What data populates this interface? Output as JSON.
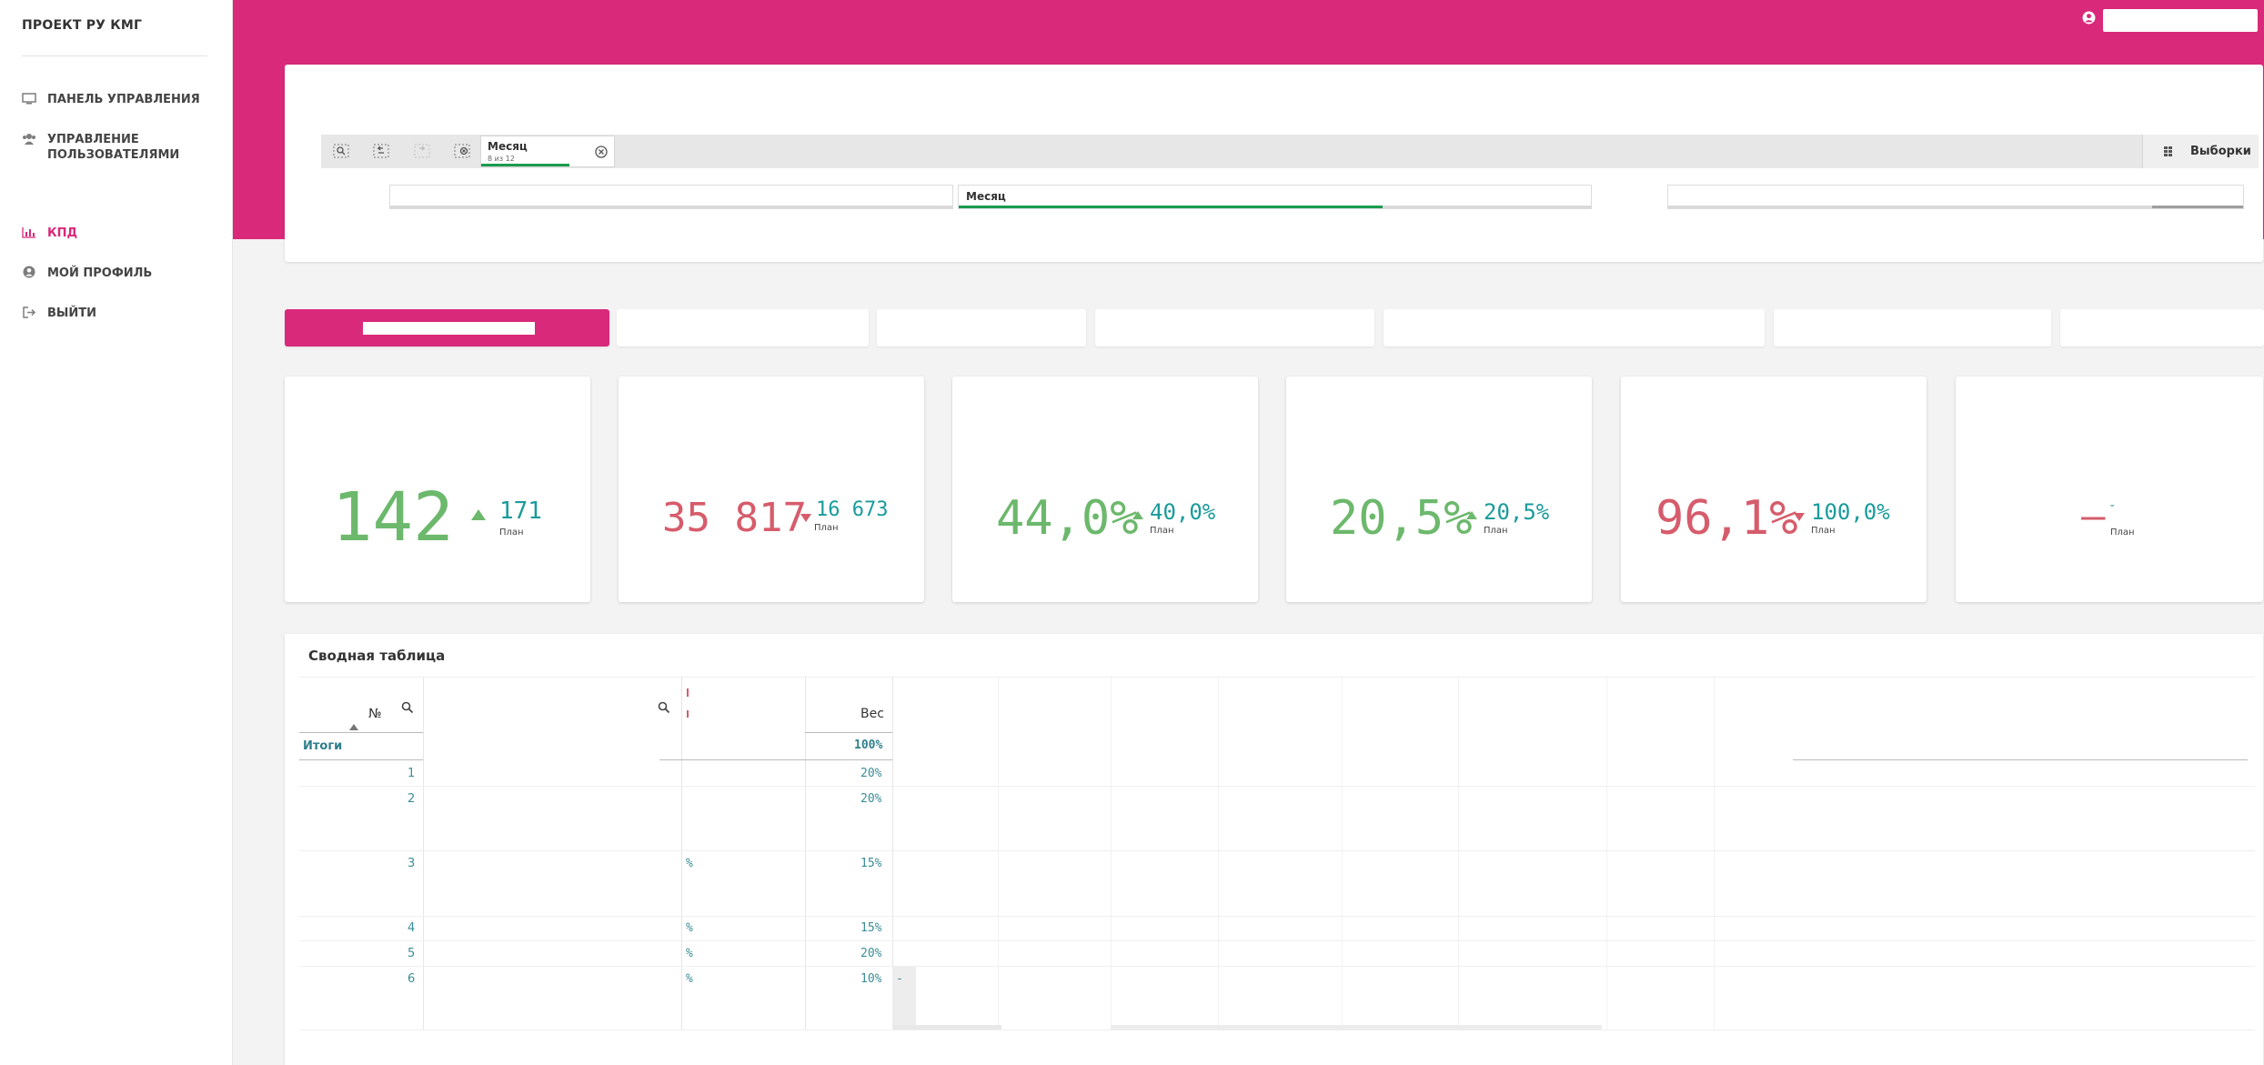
{
  "sidebar": {
    "brand": "ПРОЕКТ РУ КМГ",
    "items": [
      {
        "label": "ПАНЕЛЬ УПРАВЛЕНИЯ",
        "icon": "monitor-icon"
      },
      {
        "label": "УПРАВЛЕНИЕ ПОЛЬЗОВАТЕЛЯМИ",
        "icon": "users-icon"
      },
      {
        "label": "КПД",
        "icon": "bar-chart-icon",
        "active": true
      },
      {
        "label": "МОЙ ПРОФИЛЬ",
        "icon": "profile-icon"
      },
      {
        "label": "ВЫЙТИ",
        "icon": "logout-icon"
      }
    ]
  },
  "colors": {
    "accent": "#d9297a",
    "good": "#6cb86c",
    "bad": "#d65c6b",
    "plan": "#1a9b9b",
    "selection_green": "#1a9b4d"
  },
  "selections": {
    "chip": {
      "title": "Месяц",
      "subtitle": "8 из 12",
      "selected_fraction": 0.6667
    },
    "button": "Выборки",
    "filter_label": "Месяц",
    "filter_selected_fraction": 0.67
  },
  "kpis": [
    {
      "value": "142",
      "trend": "up",
      "status": "good",
      "plan": "171",
      "plan_label": "План"
    },
    {
      "value": "35 817",
      "trend": "down",
      "status": "bad",
      "plan": "16 673",
      "plan_label": "План"
    },
    {
      "value": "44,0%",
      "trend": "up",
      "status": "good",
      "plan": "40,0%",
      "plan_label": "План"
    },
    {
      "value": "20,5%",
      "trend": "up",
      "status": "good",
      "plan": "20,5%",
      "plan_label": "План"
    },
    {
      "value": "96,1%",
      "trend": "down",
      "status": "bad",
      "plan": "100,0%",
      "plan_label": "План"
    },
    {
      "value": "–",
      "plan": "-",
      "plan_label": "План"
    }
  ],
  "pivot": {
    "title": "Сводная таблица",
    "headers": {
      "num": "№",
      "weight": "Вес"
    },
    "totals": {
      "label": "Итоги",
      "weight": "100%"
    },
    "rows": [
      {
        "num": "1",
        "weight": "20%",
        "pct": ""
      },
      {
        "num": "2",
        "weight": "20%",
        "pct": ""
      },
      {
        "num": "3",
        "weight": "15%",
        "pct": "%"
      },
      {
        "num": "4",
        "weight": "15%",
        "pct": "%"
      },
      {
        "num": "5",
        "weight": "20%",
        "pct": "%"
      },
      {
        "num": "6",
        "weight": "10%",
        "pct": "%"
      }
    ],
    "row6_extra": "-"
  }
}
